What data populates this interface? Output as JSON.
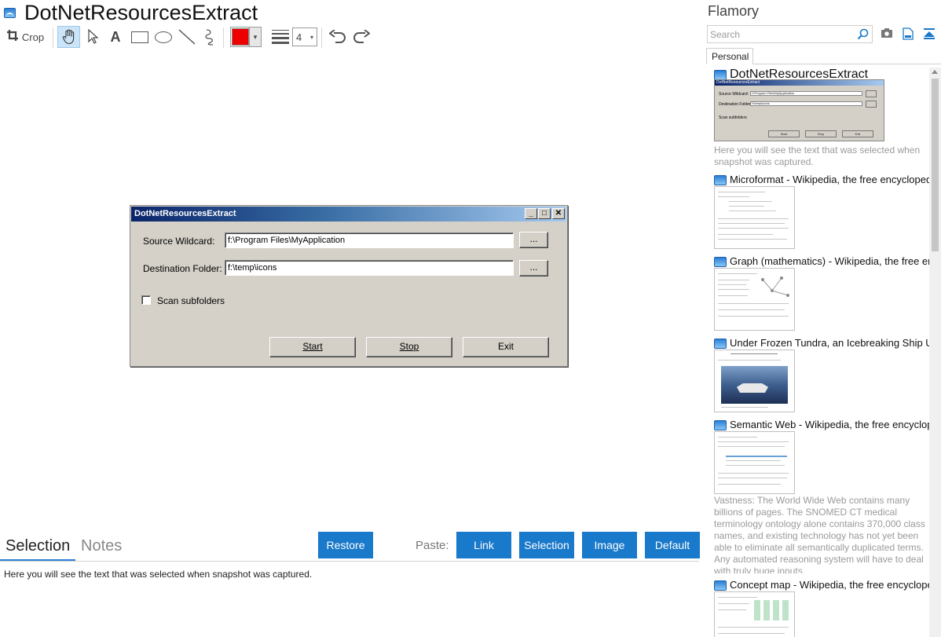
{
  "header": {
    "title": "DotNetResourcesExtract"
  },
  "toolbar": {
    "crop_label": "Crop",
    "text_tool_glyph": "A",
    "line_width_value": "4",
    "color_value": "#ee0000",
    "dropdown_glyph": "▾"
  },
  "dialog": {
    "title": "DotNetResourcesExtract",
    "min_glyph": "_",
    "max_glyph": "□",
    "close_glyph": "✕",
    "source_label": "Source Wildcard:",
    "source_value": "f:\\Program Files\\MyApplication",
    "browse_label": "...",
    "destination_label": "Destination Folder:",
    "destination_value": "f:\\temp\\icons",
    "scan_label": "Scan subfolders",
    "start_label": "Start",
    "stop_label": "Stop",
    "exit_label": "Exit"
  },
  "bottom": {
    "tab_selection": "Selection",
    "tab_notes": "Notes",
    "restore_label": "Restore",
    "paste_label": "Paste:",
    "link_label": "Link",
    "selection_label": "Selection",
    "image_label": "Image",
    "default_label": "Default",
    "selection_text": "Here you will see the text that was selected when snapshot was captured."
  },
  "sidebar": {
    "title": "Flamory",
    "search_placeholder": "Search",
    "tab_personal": "Personal",
    "snapshots": [
      {
        "title": "DotNetResourcesExtract",
        "description": "Here you will see the text that was selected when snapshot was captured.",
        "mini": {
          "title": "DotNetResourcesExtract",
          "source_label": "Source Wildcard:",
          "source_value": "f:\\Program Files\\MyApplication",
          "dest_label": "Destination Folder:",
          "dest_value": "f:\\temp\\icons",
          "scan_label": "Scan subfolders",
          "start": "Start",
          "stop": "Stop",
          "exit": "Exit"
        }
      },
      {
        "title": "Microformat - Wikipedia, the free encyclopedia"
      },
      {
        "title": "Graph (mathematics) - Wikipedia, the free ency"
      },
      {
        "title": "Under Frozen Tundra, an Icebreaking Ship Unco"
      },
      {
        "title": "Semantic Web - Wikipedia, the free encycloped",
        "description": "Vastness: The World Wide Web contains many billions of pages. The SNOMED CT medical terminology ontology alone contains 370,000 class names, and existing technology has not yet been able to eliminate all semantically duplicated terms. Any automated reasoning system will have to deal with truly huge inputs."
      },
      {
        "title": "Concept map - Wikipedia, the free encyclopedia"
      }
    ]
  },
  "colors": {
    "accent": "#1979ca",
    "selected_tool_bg": "#cce4f7",
    "dialog_bg": "#d5d1c9",
    "dialog_title_start": "#0a246a",
    "dialog_title_end": "#a6caf0"
  }
}
